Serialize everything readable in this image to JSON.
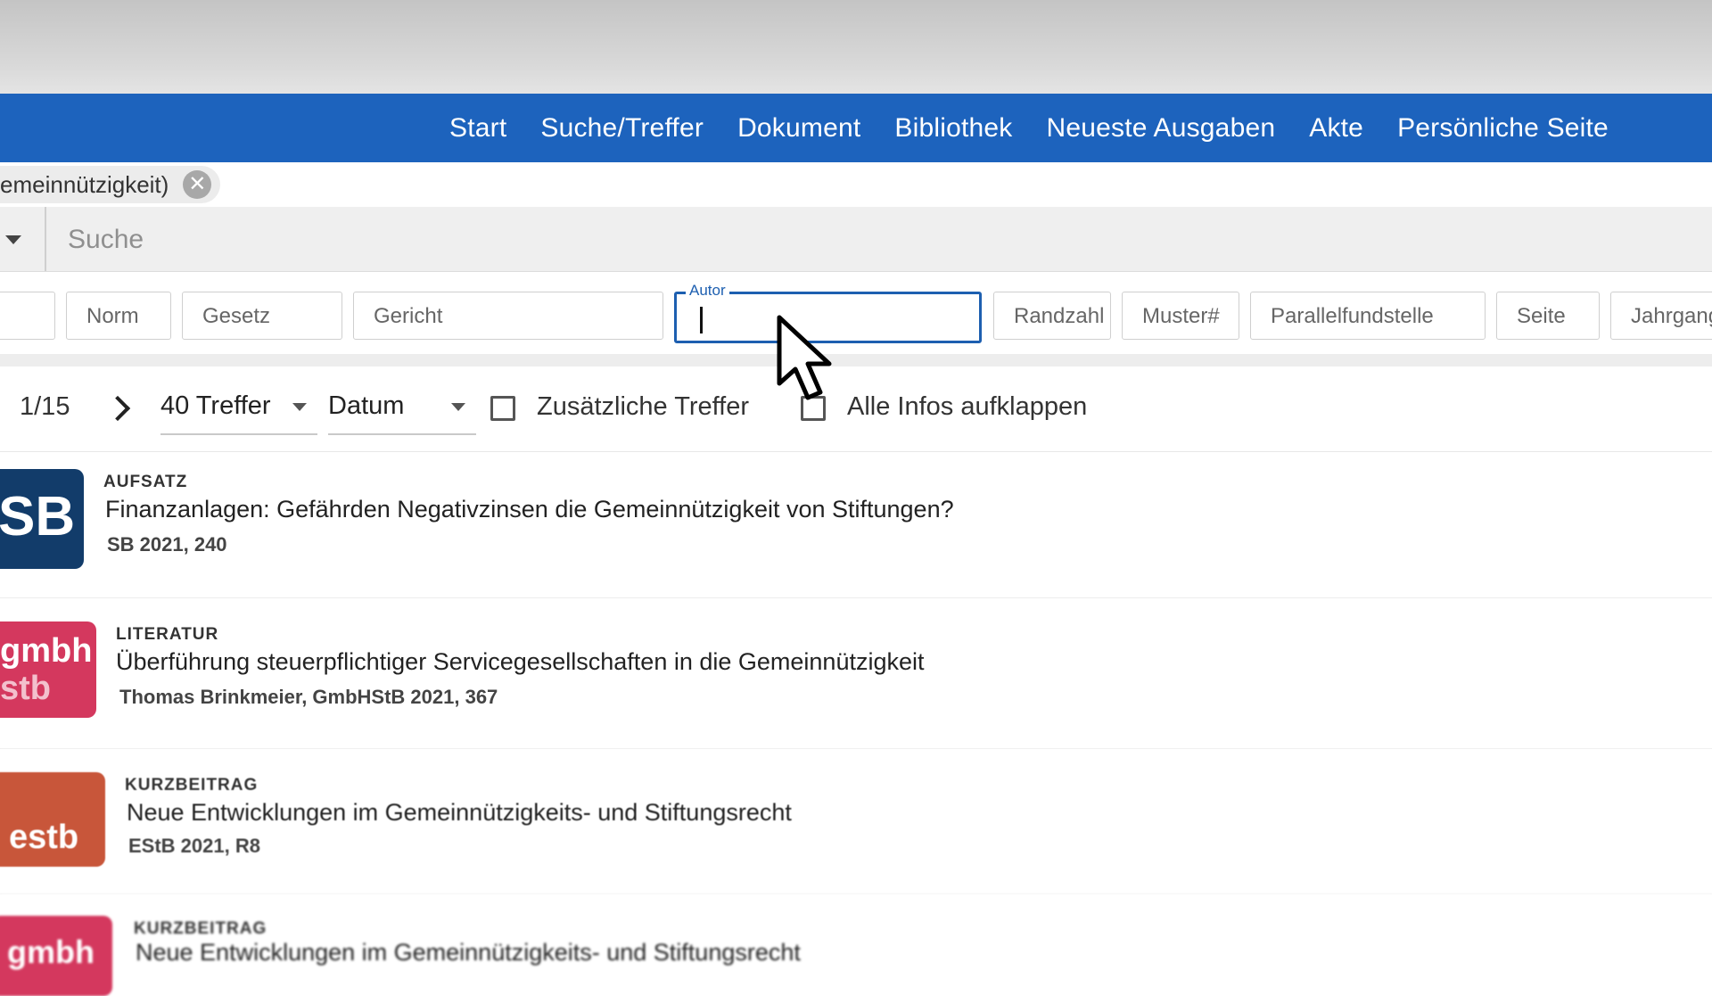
{
  "nav": {
    "items": [
      "Start",
      "Suche/Treffer",
      "Dokument",
      "Bibliothek",
      "Neueste Ausgaben",
      "Akte",
      "Persönliche Seite"
    ]
  },
  "filter_chip": {
    "label": "emeinnützigkeit)",
    "close_icon": "close-icon"
  },
  "search": {
    "placeholder": "Suche"
  },
  "fields": {
    "norm": "Norm",
    "gesetz": "Gesetz",
    "gericht": "Gericht",
    "autor_label": "Autor",
    "autor_value": "",
    "randzahl": "Randzahl",
    "muster": "Muster#",
    "parallelfundstelle": "Parallelfundstelle",
    "seite": "Seite",
    "jahrgang": "Jahrgang"
  },
  "toolbar": {
    "page": "1/15",
    "treffer": "40 Treffer",
    "sort": "Datum",
    "zusaetzliche": "Zusätzliche Treffer",
    "alle_infos": "Alle Infos aufklappen"
  },
  "results": [
    {
      "logo": "SB",
      "logo_color": "#123c6a",
      "type": "AUFSATZ",
      "title": "Finanzanlagen: Gefährden Negativzinsen die Gemeinnützigkeit von Stiftungen?",
      "source": "SB 2021, 240"
    },
    {
      "logo_line1": "gmbh",
      "logo_line2": "stb",
      "logo_color": "#d4385e",
      "type": "LITERATUR",
      "title": "Überführung steuerpflichtiger Servicegesellschaften in die Gemeinnützigkeit",
      "source": "Thomas Brinkmeier, GmbHStB 2021, 367"
    },
    {
      "logo": "estb",
      "logo_color": "#c8563a",
      "type": "KURZBEITRAG",
      "title": "Neue Entwicklungen im Gemeinnützigkeits- und Stiftungsrecht",
      "source": "EStB 2021, R8"
    },
    {
      "logo": "gmbh",
      "logo_color": "#d4385e",
      "type": "KURZBEITRAG",
      "title": "Neue Entwicklungen im Gemeinnützigkeits- und Stiftungsrecht"
    }
  ]
}
